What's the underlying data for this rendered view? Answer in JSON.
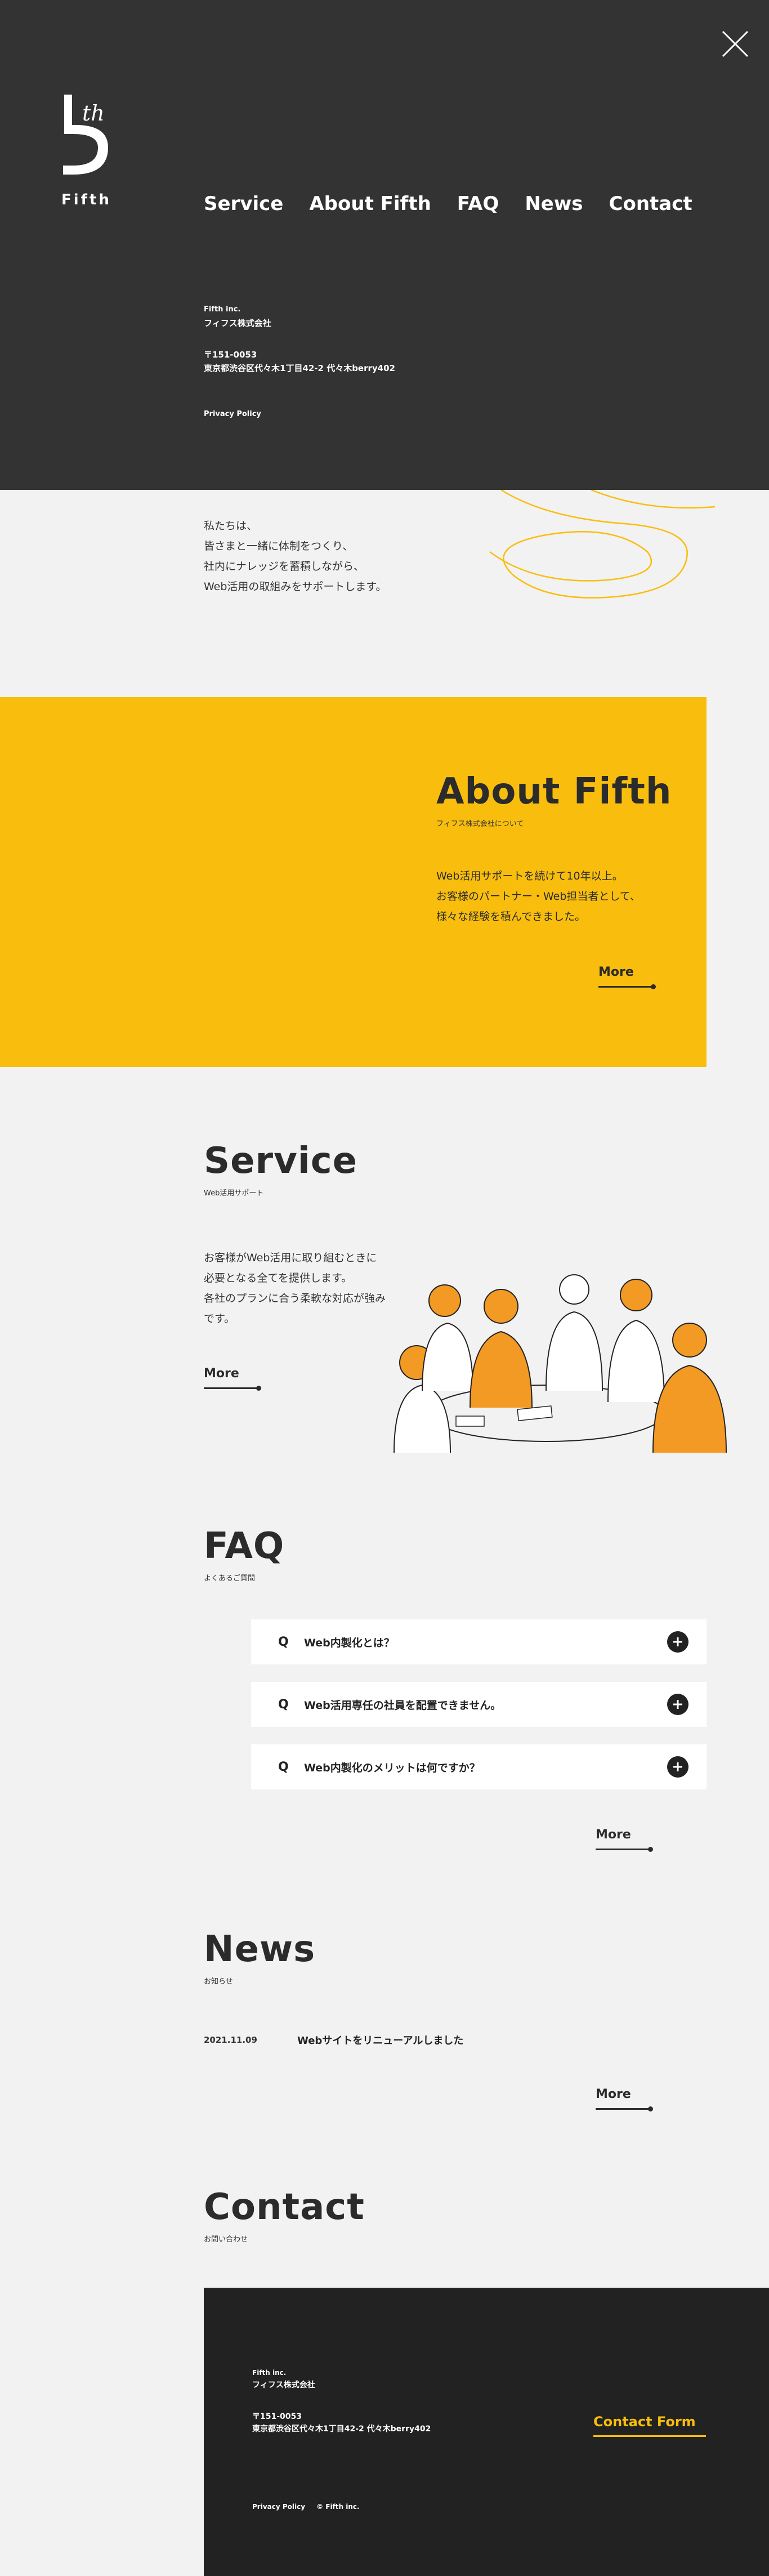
{
  "menu": {
    "logo_label": "Fifth",
    "nav": [
      "Service",
      "About Fifth",
      "FAQ",
      "News",
      "Contact"
    ],
    "company_en": "Fifth inc.",
    "company_ja": "フィフス株式会社",
    "postal": "〒151-0053",
    "address": "東京都渋谷区代々木1丁目42-2 代々木berry402",
    "privacy": "Privacy Policy"
  },
  "intro": {
    "lines": [
      "私たちは、",
      "皆さまと一緒に体制をつくり、",
      "社内にナレッジを蓄積しながら、",
      "Web活用の取組みをサポートします。"
    ]
  },
  "about": {
    "title": "About Fifth",
    "subtitle": "フィフス株式会社について",
    "lines": [
      "Web活用サポートを続けて10年以上。",
      "お客様のパートナー・Web担当者として、",
      "様々な経験を積んできました。"
    ],
    "more": "More"
  },
  "service": {
    "title": "Service",
    "subtitle": "Web活用サポート",
    "lines": [
      "お客様がWeb活用に取り組むときに",
      "必要となる全てを提供します。",
      "各社のプランに合う柔軟な対応が強み",
      "です。"
    ],
    "more": "More"
  },
  "faq": {
    "title": "FAQ",
    "subtitle": "よくあるご質問",
    "q_mark": "Q",
    "items": [
      "Web内製化とは？",
      "Web活用専任の社員を配置できません。",
      "Web内製化のメリットは何ですか？"
    ],
    "more": "More"
  },
  "news": {
    "title": "News",
    "subtitle": "お知らせ",
    "items": [
      {
        "date": "2021.11.09",
        "text": "Webサイトをリニューアルしました"
      }
    ],
    "more": "More"
  },
  "contact": {
    "title": "Contact",
    "subtitle": "お問い合わせ",
    "company_en": "Fifth inc.",
    "company_ja": "フィフス株式会社",
    "postal": "〒151-0053",
    "address": "東京都渋谷区代々木1丁目42-2 代々木berry402",
    "form_link": "Contact Form",
    "privacy": "Privacy Policy",
    "copyright": "© Fifth inc."
  },
  "colors": {
    "dark": "#333333",
    "accent": "#f9be0d",
    "footer": "#222222"
  }
}
